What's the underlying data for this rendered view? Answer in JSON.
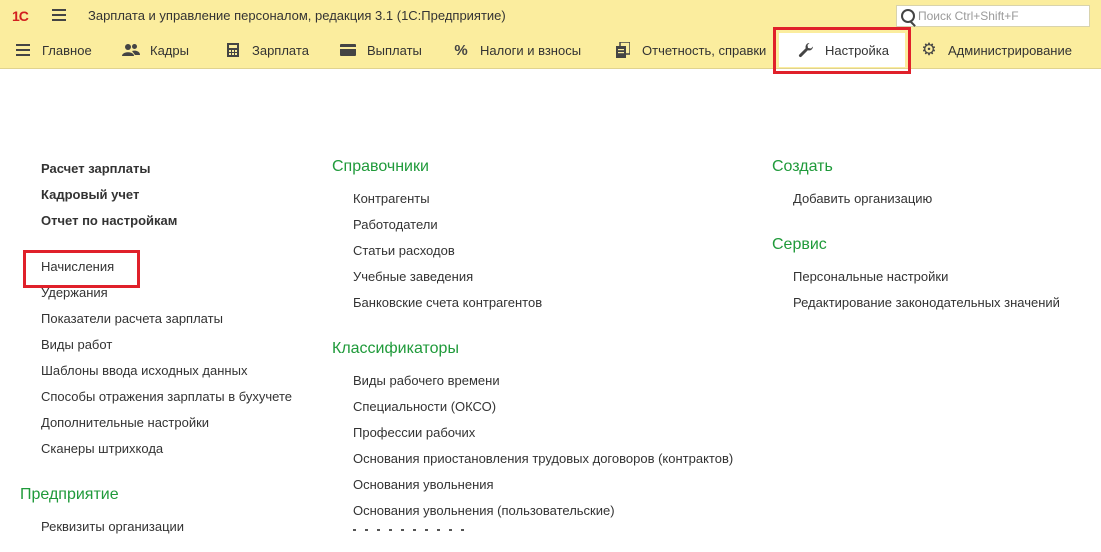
{
  "titlebar": {
    "logo": "1С",
    "app_title": "Зарплата и управление персоналом, редакция 3.1  (1С:Предприятие)",
    "search_placeholder": "Поиск Ctrl+Shift+F"
  },
  "navbar": {
    "items": [
      {
        "label": "Главное",
        "icon": "list-icon"
      },
      {
        "label": "Кадры",
        "icon": "people-icon"
      },
      {
        "label": "Зарплата",
        "icon": "calculator-icon"
      },
      {
        "label": "Выплаты",
        "icon": "card-icon"
      },
      {
        "label": "Налоги и взносы",
        "icon": "percent-icon"
      },
      {
        "label": "Отчетность, справки",
        "icon": "documents-icon"
      },
      {
        "label": "Настройка",
        "icon": "wrench-icon",
        "active": true
      },
      {
        "label": "Администрирование",
        "icon": "gear-icon"
      }
    ]
  },
  "left_column": {
    "bold_links": [
      "Расчет зарплаты",
      "Кадровый учет",
      "Отчет по настройкам"
    ],
    "links": [
      "Начисления",
      "Удержания",
      "Показатели расчета зарплаты",
      "Виды работ",
      "Шаблоны ввода исходных данных",
      "Способы отражения зарплаты в бухучете",
      "Дополнительные настройки",
      "Сканеры штрихкода"
    ],
    "section2_title": "Предприятие",
    "section2_links": [
      "Реквизиты организации"
    ]
  },
  "middle_column": {
    "section1_title": "Справочники",
    "section1_links": [
      "Контрагенты",
      "Работодатели",
      "Статьи расходов",
      "Учебные заведения",
      "Банковские счета контрагентов"
    ],
    "section2_title": "Классификаторы",
    "section2_links": [
      "Виды рабочего времени",
      "Специальности (ОКСО)",
      "Профессии рабочих",
      "Основания приостановления трудовых договоров (контрактов)",
      "Основания увольнения",
      "Основания увольнения (пользовательские)"
    ]
  },
  "right_column": {
    "section1_title": "Создать",
    "section1_links": [
      "Добавить организацию"
    ],
    "section2_title": "Сервис",
    "section2_links": [
      "Персональные настройки",
      "Редактирование законодательных значений"
    ]
  },
  "colors": {
    "bar_background": "#fbed9e",
    "section_title": "#1f9a3a",
    "highlight": "#e0202a"
  }
}
